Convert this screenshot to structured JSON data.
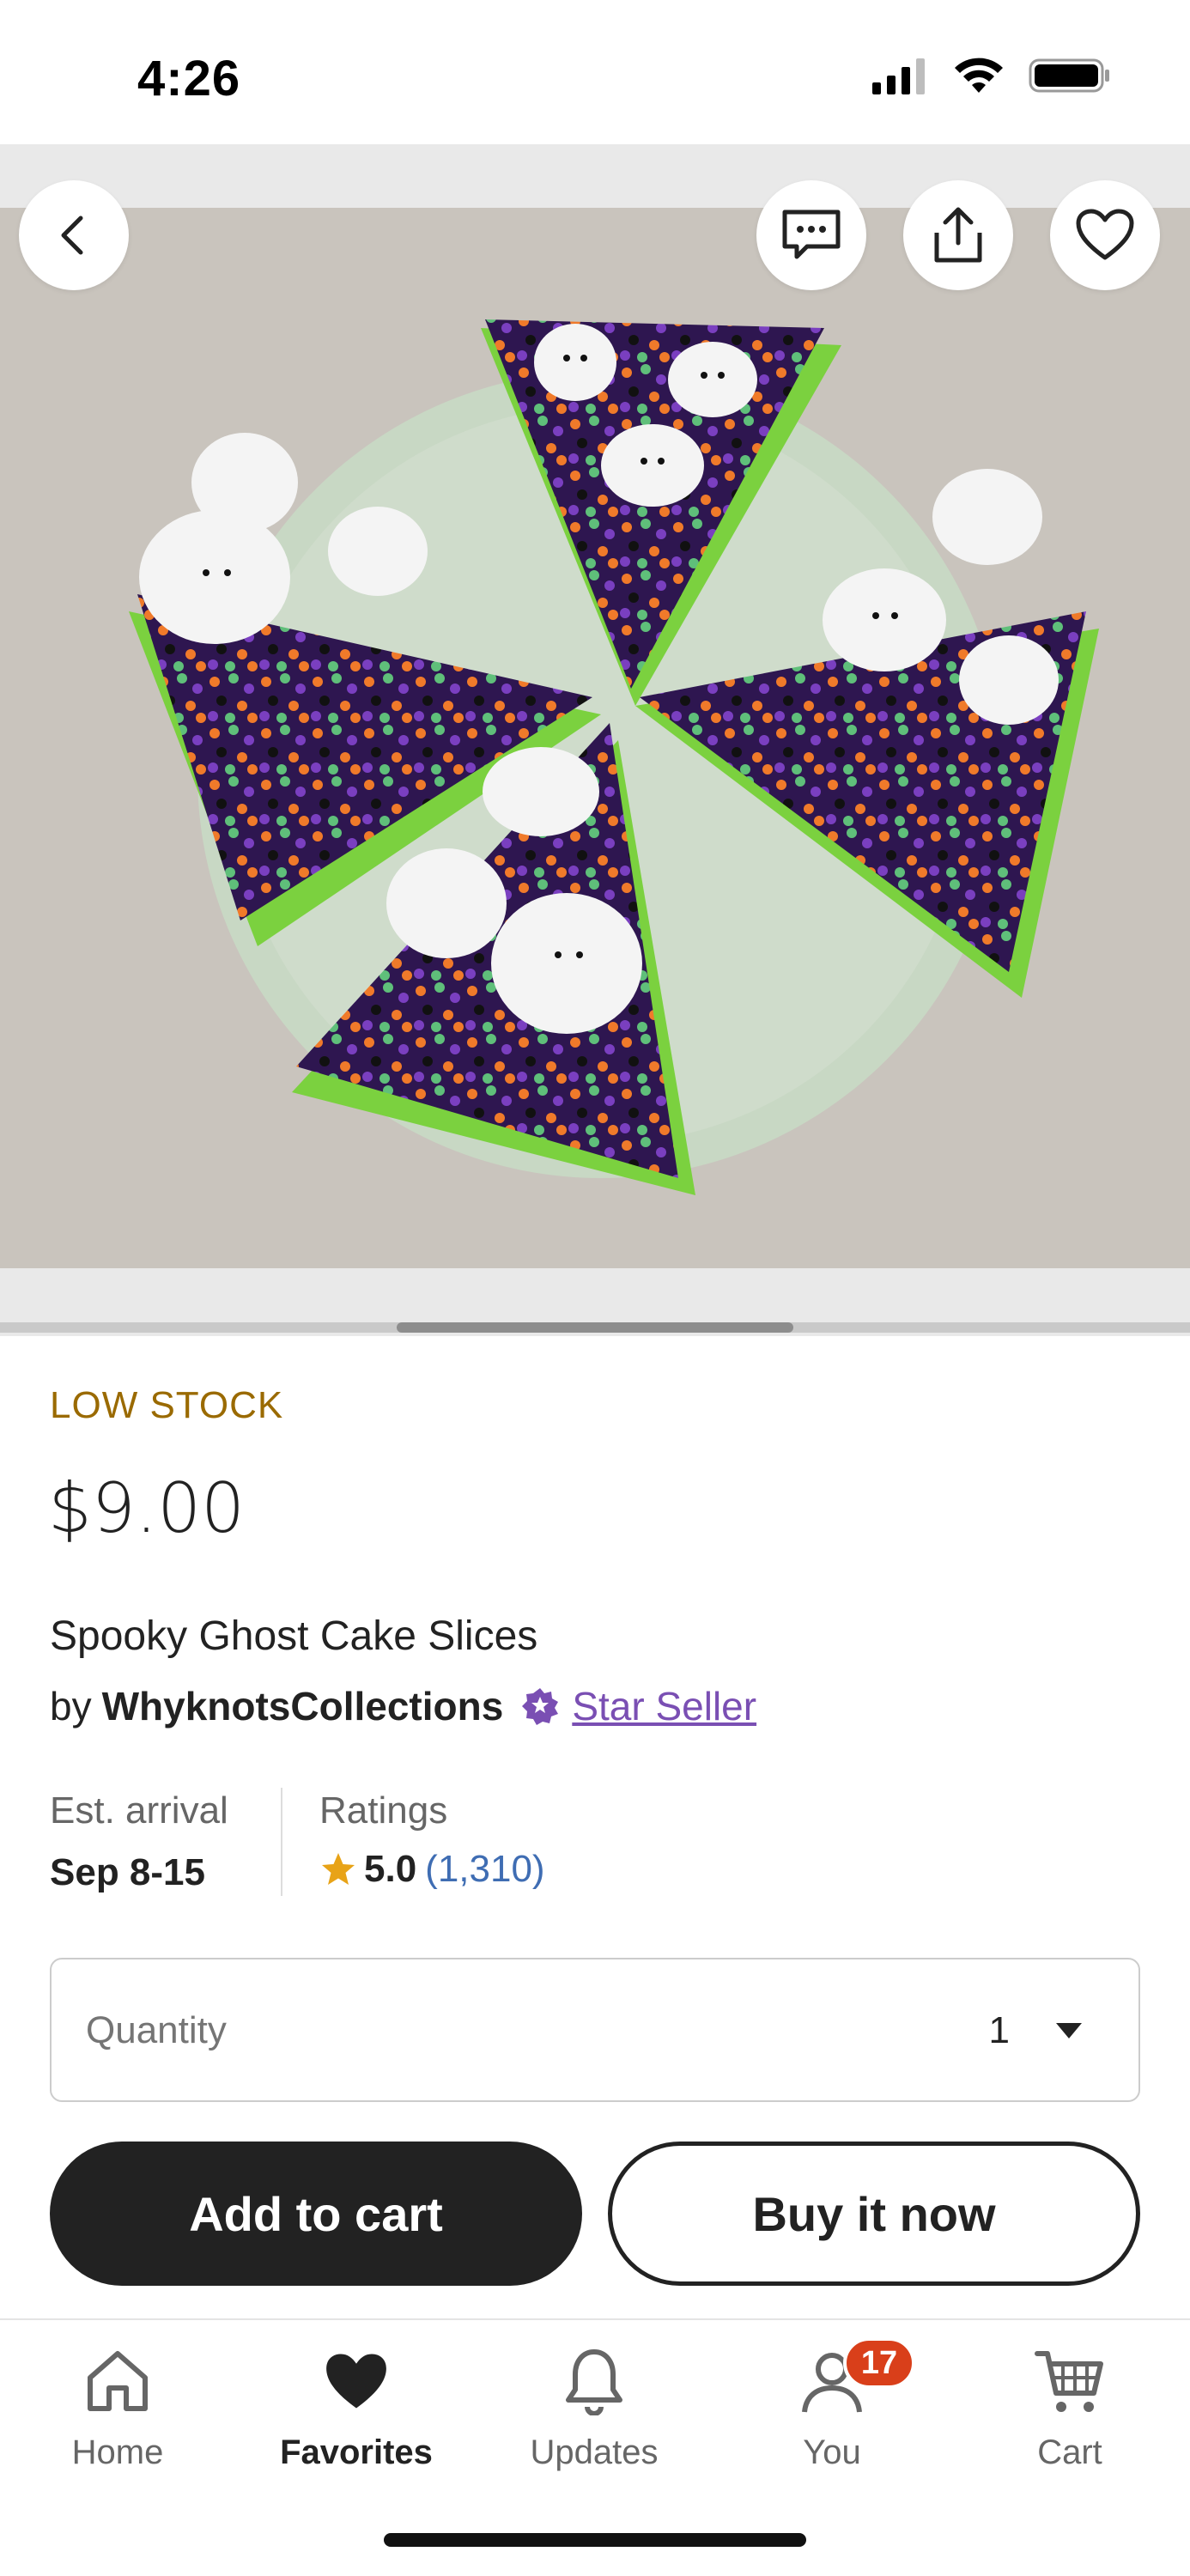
{
  "status_bar": {
    "time": "4:26",
    "icons": [
      "signal-icon",
      "wifi-icon",
      "battery-icon"
    ]
  },
  "gallery": {
    "image_alt": "Felt ghost cake slices with sprinkles on a plate",
    "scroll_position": 0.33,
    "actions": [
      "back-icon",
      "message-icon",
      "share-icon",
      "heart-icon"
    ]
  },
  "listing": {
    "stock_status": "LOW STOCK",
    "price": "$9.00",
    "title": "Spooky Ghost Cake Slices",
    "by_label": "by",
    "seller": "WhyknotsCollections",
    "star_seller_label": "Star Seller",
    "est_arrival_label": "Est. arrival",
    "est_arrival_value": "Sep 8-15",
    "ratings_label": "Ratings",
    "rating": "5.0",
    "ratings_count": "(1,310)"
  },
  "quantity": {
    "label": "Quantity",
    "value": "1"
  },
  "actions": {
    "add_to_cart": "Add to cart",
    "buy_now": "Buy it now"
  },
  "nav": {
    "items": [
      {
        "label": "Home",
        "icon": "home-icon"
      },
      {
        "label": "Favorites",
        "icon": "heart-filled-icon",
        "active": true
      },
      {
        "label": "Updates",
        "icon": "bell-icon"
      },
      {
        "label": "You",
        "icon": "user-icon",
        "badge": "17"
      },
      {
        "label": "Cart",
        "icon": "cart-icon"
      }
    ]
  },
  "colors": {
    "low_stock": "#9a6a00",
    "star_seller": "#7a4fb3",
    "link_blue": "#3f6db3",
    "rating_star": "#e8a317",
    "badge": "#d93f1a",
    "primary_dark": "#222222"
  }
}
